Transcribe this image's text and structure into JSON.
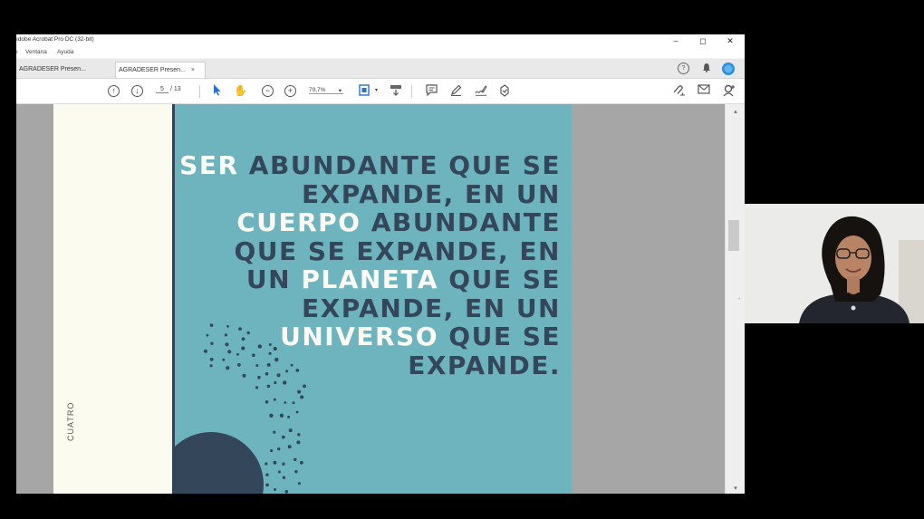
{
  "window": {
    "title": "ıdobe Acrobat Pro DC (32-bit)",
    "controls": [
      "–",
      "◻",
      "✕"
    ]
  },
  "menu": [
    "ı",
    "Ventana",
    "Ayuda"
  ],
  "tabs": [
    {
      "label": "AGRADESER Presen..."
    },
    {
      "label": "AGRADESER Presen...",
      "close": "×"
    }
  ],
  "toolbar": {
    "current_page": "5",
    "page_total": "/ 13",
    "zoom": "79,7%"
  },
  "page": {
    "side_label": "CUATRO",
    "quote_lines": [
      [
        {
          "t": "SER",
          "hl": true
        },
        {
          "t": " ABUNDANTE QUE SE",
          "hl": false
        }
      ],
      [
        {
          "t": "EXPANDE, EN UN",
          "hl": false
        }
      ],
      [
        {
          "t": "CUERPO",
          "hl": true
        },
        {
          "t": " ABUNDANTE",
          "hl": false
        }
      ],
      [
        {
          "t": "QUE SE EXPANDE, EN",
          "hl": false
        }
      ],
      [
        {
          "t": "UN ",
          "hl": false
        },
        {
          "t": "PLANETA",
          "hl": true
        },
        {
          "t": " QUE SE",
          "hl": false
        }
      ],
      [
        {
          "t": "EXPANDE, EN UN",
          "hl": false
        }
      ],
      [
        {
          "t": "UNIVERSO",
          "hl": true
        },
        {
          "t": " QUE SE",
          "hl": false
        }
      ],
      [
        {
          "t": "EXPANDE.",
          "hl": false
        }
      ]
    ]
  },
  "colors": {
    "teal": "#6eb4bf",
    "navy": "#34475a",
    "cream": "#fcfbf0",
    "highlight": "#fbfaf3"
  }
}
